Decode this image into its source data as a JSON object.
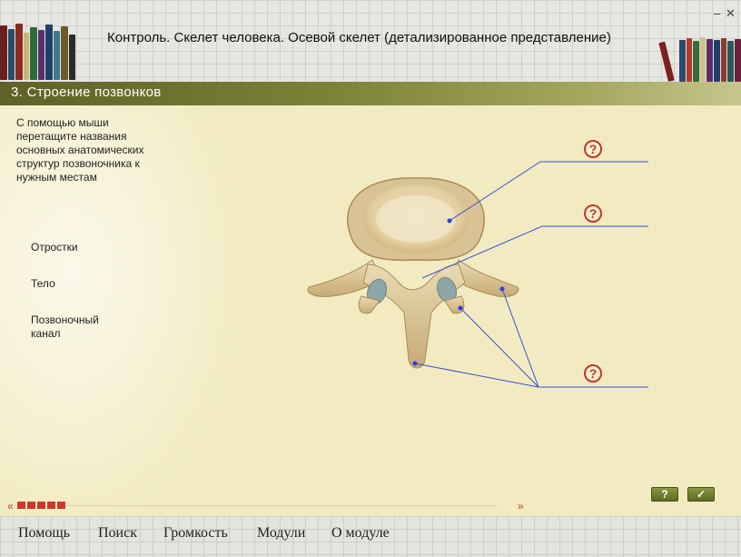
{
  "window": {
    "title": "Контроль. Скелет человека. Осевой скелет (детализированное представление)",
    "minimize_glyph": "–",
    "close_glyph": "✕"
  },
  "section": {
    "title": "3. Строение позвонков"
  },
  "instructions": "С помощью мыши перетащите названия основных анатомических структур позвоночника к нужным местам",
  "terms": [
    "Отростки",
    "Тело",
    "Позвоночный канал"
  ],
  "drop_targets": [
    {
      "label": "?",
      "icon": "question-circle-icon"
    },
    {
      "label": "?",
      "icon": "question-circle-icon"
    },
    {
      "label": "?",
      "icon": "question-circle-icon"
    }
  ],
  "navigation": {
    "prev_glyph": "«",
    "next_glyph": "»",
    "progress_steps_done": 5,
    "help_button": "?",
    "check_button": "✓"
  },
  "menu": [
    "Помощь",
    "Поиск",
    "Громкость",
    "Модули",
    "О модуле"
  ],
  "colors": {
    "section_bar": "#7c8236",
    "panel": "#f2ebc1",
    "pointer_lines": "#3b4fd6",
    "question": "#c0362c",
    "progress": "#d1362b"
  }
}
